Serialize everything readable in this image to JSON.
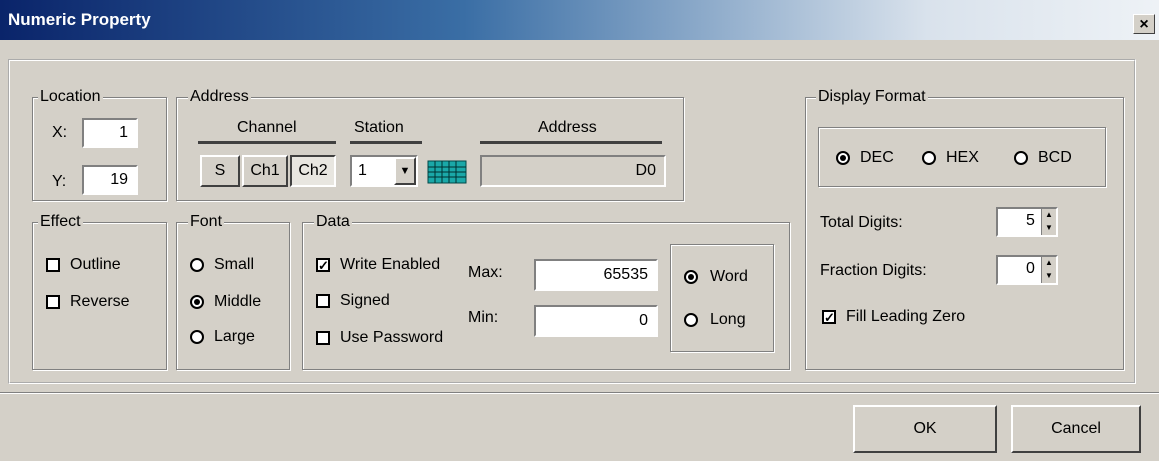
{
  "window": {
    "title": "Numeric Property",
    "close": "×"
  },
  "location": {
    "legend": "Location",
    "x_label": "X:",
    "x_value": "1",
    "y_label": "Y:",
    "y_value": "19"
  },
  "address": {
    "legend": "Address",
    "channel_header": "Channel",
    "station_header": "Station",
    "address_header": "Address",
    "channel_buttons": [
      "S",
      "Ch1",
      "Ch2"
    ],
    "station_value": "1",
    "address_value": "D0"
  },
  "effect": {
    "legend": "Effect",
    "outline": "Outline",
    "reverse": "Reverse"
  },
  "font": {
    "legend": "Font",
    "small": "Small",
    "middle": "Middle",
    "large": "Large",
    "selected": "Middle"
  },
  "data": {
    "legend": "Data",
    "write_enabled": "Write Enabled",
    "signed": "Signed",
    "use_password": "Use Password",
    "max_label": "Max:",
    "max_value": "65535",
    "min_label": "Min:",
    "min_value": "0",
    "word": "Word",
    "long": "Long",
    "selected": "Word"
  },
  "display_format": {
    "legend": "Display Format",
    "dec": "DEC",
    "hex": "HEX",
    "bcd": "BCD",
    "selected": "DEC",
    "total_digits_label": "Total Digits:",
    "total_digits_value": "5",
    "fraction_digits_label": "Fraction Digits:",
    "fraction_digits_value": "0",
    "fill_leading_zero": "Fill Leading Zero"
  },
  "buttons": {
    "ok": "OK",
    "cancel": "Cancel"
  },
  "icons": {
    "keypad": "keypad-grid-icon",
    "dropdown": "dropdown-arrow-icon",
    "spin_up": "spin-up-icon",
    "spin_down": "spin-down-icon"
  },
  "colors": {
    "title_start": "#0a246a",
    "face": "#d4d0c8",
    "keypad": "#1aa8a8"
  }
}
